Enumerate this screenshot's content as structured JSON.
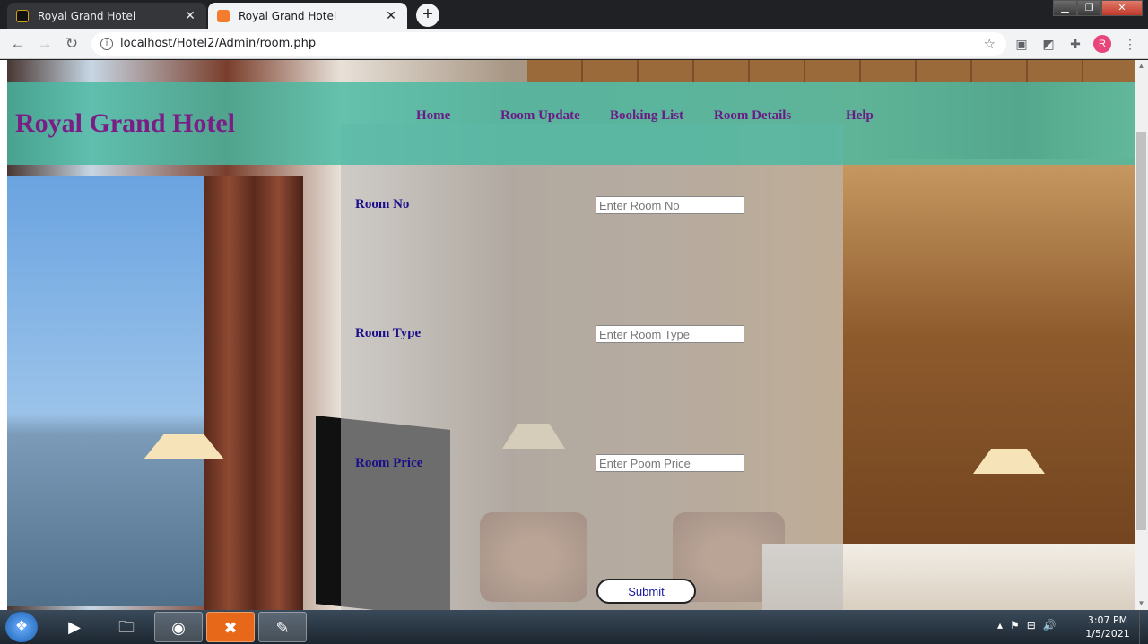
{
  "browser": {
    "tabs": [
      {
        "title": "Royal Grand Hotel",
        "active": false
      },
      {
        "title": "Royal Grand Hotel",
        "active": true
      }
    ],
    "url": "localhost/Hotel2/Admin/room.php",
    "avatar_initial": "R"
  },
  "site": {
    "title": "Royal Grand Hotel",
    "nav": [
      "Home",
      "Room Update",
      "Booking List",
      "Room Details",
      "Help"
    ]
  },
  "form": {
    "room_no": {
      "label": "Room No",
      "placeholder": "Enter Room No"
    },
    "room_type": {
      "label": "Room Type",
      "placeholder": "Enter Room Type"
    },
    "room_price": {
      "label": "Room Price",
      "placeholder": "Enter Poom Price"
    },
    "submit_label": "Submit"
  },
  "taskbar": {
    "time": "3:07 PM",
    "date": "1/5/2021"
  },
  "colors": {
    "header_bg": "#48baa2",
    "logo": "#7a1e86",
    "label": "#1a0f8a"
  }
}
